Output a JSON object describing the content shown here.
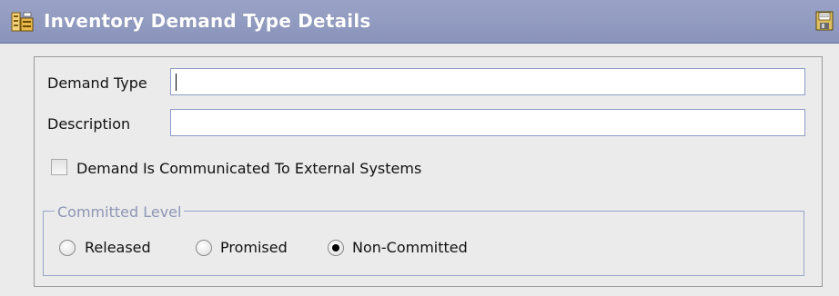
{
  "window": {
    "title": "Inventory Demand Type Details",
    "title_icon": "inventory-details-icon",
    "save_icon": "save-icon"
  },
  "form": {
    "demand_type": {
      "label": "Demand Type",
      "value": ""
    },
    "description": {
      "label": "Description",
      "value": ""
    },
    "communicated": {
      "label": "Demand Is Communicated To External Systems",
      "checked": false
    }
  },
  "committed_level": {
    "legend": "Committed Level",
    "options": [
      {
        "label": "Released",
        "selected": false
      },
      {
        "label": "Promised",
        "selected": false
      },
      {
        "label": "Non-Committed",
        "selected": true
      }
    ]
  },
  "colors": {
    "titlebar": "#8a93bb",
    "field_border": "#8f9ac8",
    "group_border": "#9aa4cc",
    "legend_text": "#8d96b5",
    "background": "#ebebeb"
  }
}
